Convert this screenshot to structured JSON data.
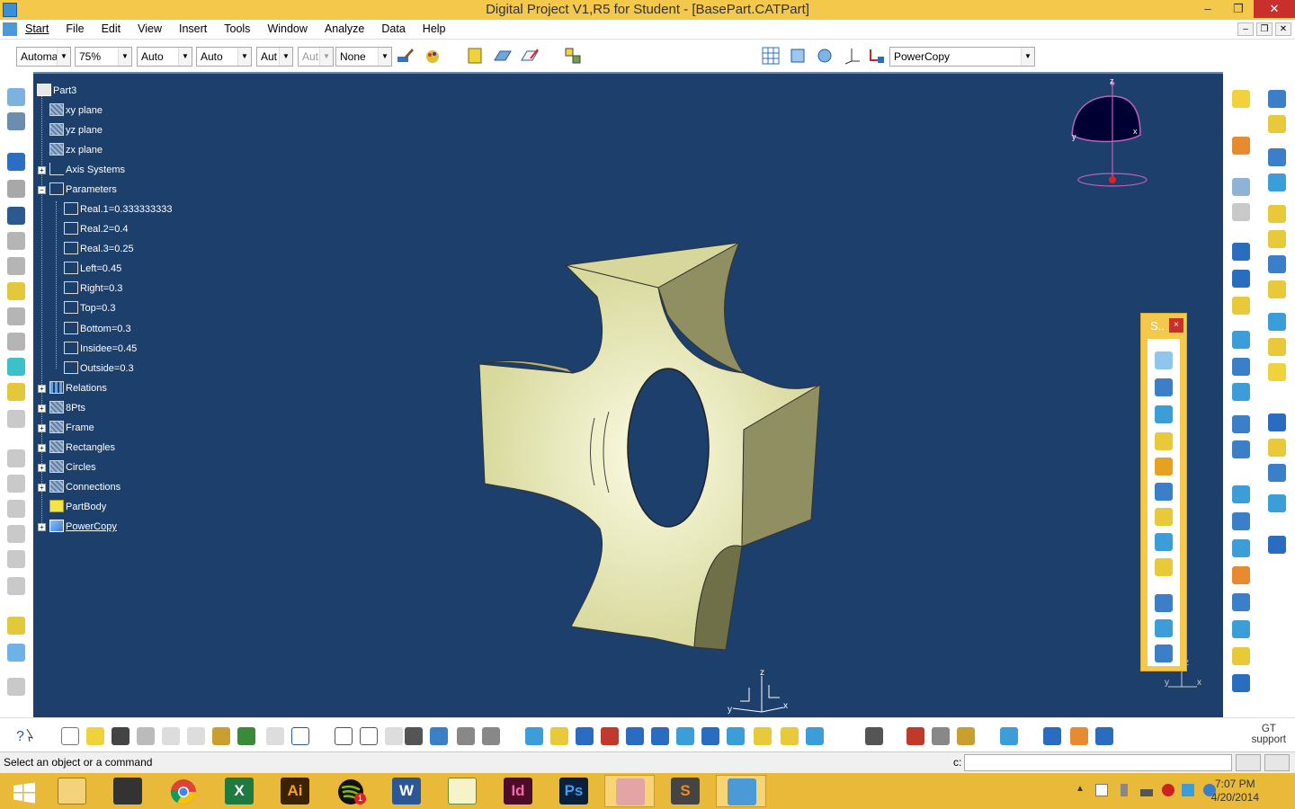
{
  "window": {
    "title": "Digital Project V1,R5 for Student - [BasePart.CATPart]",
    "minimize": "–",
    "maximize": "❐",
    "close": "✕"
  },
  "menu": {
    "items": [
      "Start",
      "File",
      "Edit",
      "View",
      "Insert",
      "Tools",
      "Window",
      "Analyze",
      "Data",
      "Help"
    ]
  },
  "toolbar": {
    "dropdowns": [
      {
        "value": "Automa"
      },
      {
        "value": "75%"
      },
      {
        "value": "Auto"
      },
      {
        "value": "Auto"
      },
      {
        "value": "Aut"
      },
      {
        "value": "Aut",
        "disabled": true
      },
      {
        "value": "None"
      }
    ],
    "powercopy_select": "PowerCopy"
  },
  "tree": {
    "nodes": [
      {
        "label": "Part3",
        "icon": "part-icon",
        "level": 0
      },
      {
        "label": "xy plane",
        "icon": "plane-icon",
        "level": 1
      },
      {
        "label": "yz plane",
        "icon": "plane-icon",
        "level": 1
      },
      {
        "label": "zx plane",
        "icon": "plane-icon",
        "level": 1
      },
      {
        "label": "Axis Systems",
        "icon": "axis-system-icon",
        "level": 1,
        "expandable": true
      },
      {
        "label": "Parameters",
        "icon": "parameters-icon",
        "level": 1,
        "expandable": true,
        "expanded": true
      },
      {
        "label": "Real.1=0.333333333",
        "icon": "parameter-icon",
        "level": 2
      },
      {
        "label": "Real.2=0.4",
        "icon": "parameter-icon",
        "level": 2
      },
      {
        "label": "Real.3=0.25",
        "icon": "parameter-icon",
        "level": 2
      },
      {
        "label": "Left=0.45",
        "icon": "parameter-icon",
        "level": 2
      },
      {
        "label": "Right=0.3",
        "icon": "parameter-icon",
        "level": 2
      },
      {
        "label": "Top=0.3",
        "icon": "parameter-icon",
        "level": 2
      },
      {
        "label": "Bottom=0.3",
        "icon": "parameter-icon",
        "level": 2
      },
      {
        "label": "Insidee=0.45",
        "icon": "parameter-icon",
        "level": 2
      },
      {
        "label": "Outside=0.3",
        "icon": "parameter-icon",
        "level": 2
      },
      {
        "label": "Relations",
        "icon": "relations-icon",
        "level": 1,
        "expandable": true
      },
      {
        "label": "8Pts",
        "icon": "geometrical-set-icon",
        "level": 1,
        "expandable": true
      },
      {
        "label": "Frame",
        "icon": "geometrical-set-icon",
        "level": 1,
        "expandable": true
      },
      {
        "label": "Rectangles",
        "icon": "geometrical-set-icon",
        "level": 1,
        "expandable": true
      },
      {
        "label": "Circles",
        "icon": "geometrical-set-icon",
        "level": 1,
        "expandable": true
      },
      {
        "label": "Connections",
        "icon": "geometrical-set-icon",
        "level": 1,
        "expandable": true
      },
      {
        "label": "PartBody",
        "icon": "body-icon",
        "level": 1
      },
      {
        "label": "PowerCopy",
        "icon": "powercopy-icon",
        "level": 1,
        "expandable": true,
        "underlined": true
      }
    ]
  },
  "compass": {
    "x": "x",
    "y": "y",
    "z": "z"
  },
  "axis_triad": {
    "x": "x",
    "y": "y",
    "z": "z"
  },
  "float_toolbar": {
    "title": "S..",
    "close": "×"
  },
  "status": {
    "message": "Select an object or a command",
    "command_label": "c:"
  },
  "gt_support": {
    "line1": "GT",
    "line2": "support"
  },
  "taskbar": {
    "apps": [
      "windows-explorer",
      "visual-studio",
      "chrome",
      "excel",
      "illustrator",
      "spotify",
      "word",
      "notepad-plus",
      "indesign",
      "photoshop",
      "snipping-tool",
      "sublime-text",
      "digital-project"
    ],
    "labels": {
      "ai": "Ai",
      "id": "Id",
      "ps": "Ps",
      "word": "W",
      "excel": "X",
      "sublime": "S"
    },
    "spotify_badge": "1",
    "time": "7:07 PM",
    "date": "4/20/2014"
  },
  "colors": {
    "titlebar": "#f3c84b",
    "viewport": "#1d3f6b",
    "part_face": "#d8d99c",
    "part_shadow": "#8f8f62",
    "taskbar": "#e9b93a"
  }
}
